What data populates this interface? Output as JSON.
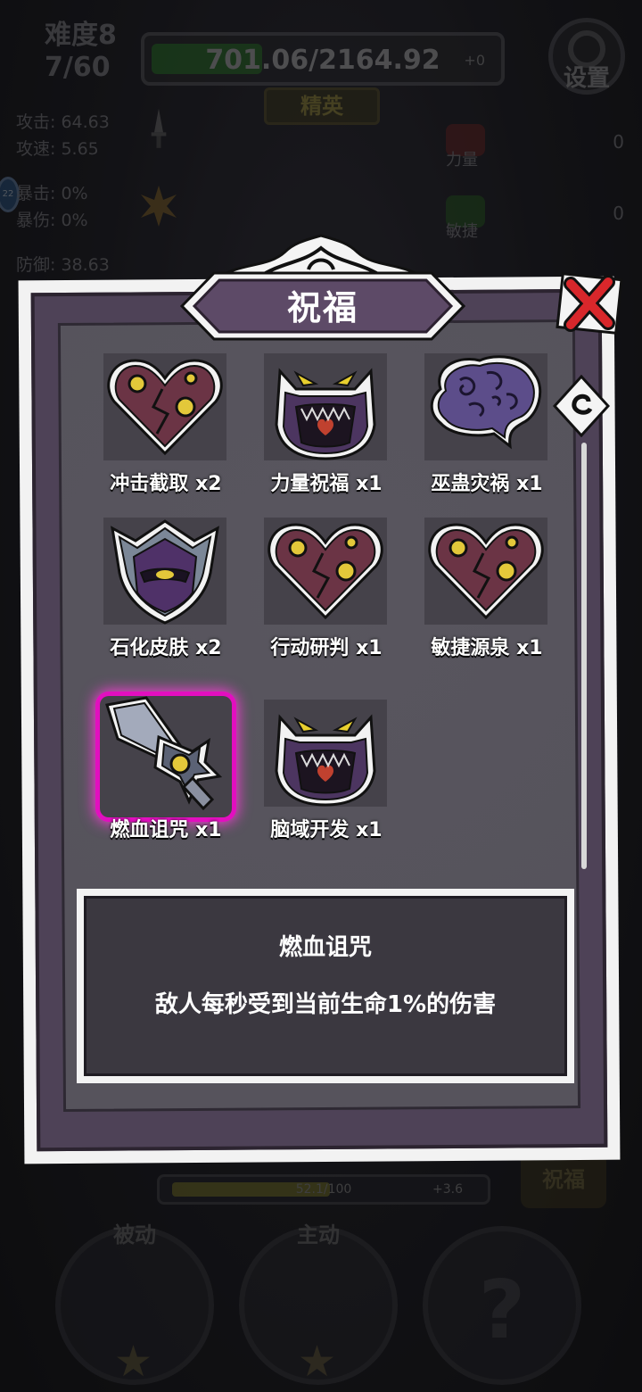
{
  "hud": {
    "difficulty": "难度8",
    "wave": "7/60",
    "hp_text": "701.06/2164.92",
    "hp_fraction": 0.324,
    "hp_extra": "+0",
    "rank": "精英",
    "settings_label": "设置",
    "badge_count": "22"
  },
  "stats": {
    "attack": "攻击: 64.63",
    "attack_speed": "攻速: 5.65",
    "crit": "暴击: 0%",
    "crit_damage": "暴伤: 0%",
    "defense": "防御: 38.63"
  },
  "attributes": [
    {
      "name": "力量",
      "value": "0",
      "color": "#8a2b2b",
      "icon": "fist-icon"
    },
    {
      "name": "敏捷",
      "value": "0",
      "color": "#2f6b2a",
      "icon": "feather-icon"
    }
  ],
  "bottom": {
    "xp_text": "52.1/100",
    "xp_fraction": 0.521,
    "xp_extra": "+3.6",
    "bless_button": "祝福",
    "passive_label": "被动",
    "active_label": "主动",
    "unknown_slot": "?"
  },
  "modal": {
    "title": "祝福",
    "items": [
      {
        "name": "冲击截取 x2",
        "icon": "heart-icon"
      },
      {
        "name": "力量祝福 x1",
        "icon": "monster-icon"
      },
      {
        "name": "巫蛊灾祸 x1",
        "icon": "brain-icon"
      },
      {
        "name": "石化皮肤 x2",
        "icon": "helmet-shield-icon"
      },
      {
        "name": "行动研判 x1",
        "icon": "heart-icon"
      },
      {
        "name": "敏捷源泉 x1",
        "icon": "heart-icon"
      },
      {
        "name": "燃血诅咒 x1",
        "icon": "sword-icon",
        "selected": true
      },
      {
        "name": "脑域开发 x1",
        "icon": "monster-icon"
      }
    ],
    "detail": {
      "title": "燃血诅咒",
      "description": "敌人每秒受到当前生命1%的伤害"
    }
  }
}
